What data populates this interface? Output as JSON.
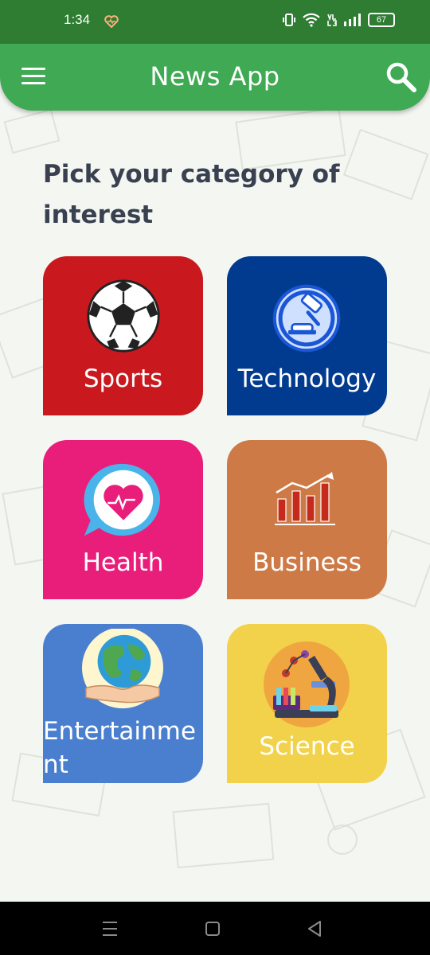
{
  "status_bar": {
    "time": "1:34",
    "battery": "67"
  },
  "app_bar": {
    "title": "News App"
  },
  "heading": "Pick your category of interest",
  "categories": [
    {
      "label": "Sports",
      "color": "#c9191e",
      "icon": "soccer-ball-icon"
    },
    {
      "label": "Technology",
      "color": "#003b8f",
      "icon": "gavel-icon"
    },
    {
      "label": "Health",
      "color": "#e91e7a",
      "icon": "heart-chat-icon"
    },
    {
      "label": "Business",
      "color": "#cd7a47",
      "icon": "bar-chart-icon"
    },
    {
      "label": "Entertainment",
      "color": "#4a7fcf",
      "icon": "globe-hands-icon"
    },
    {
      "label": "Science",
      "color": "#f2d24b",
      "icon": "microscope-icon"
    }
  ],
  "colors": {
    "status_bar": "#2e7d32",
    "app_bar": "#3faa53",
    "heading": "#394150"
  }
}
